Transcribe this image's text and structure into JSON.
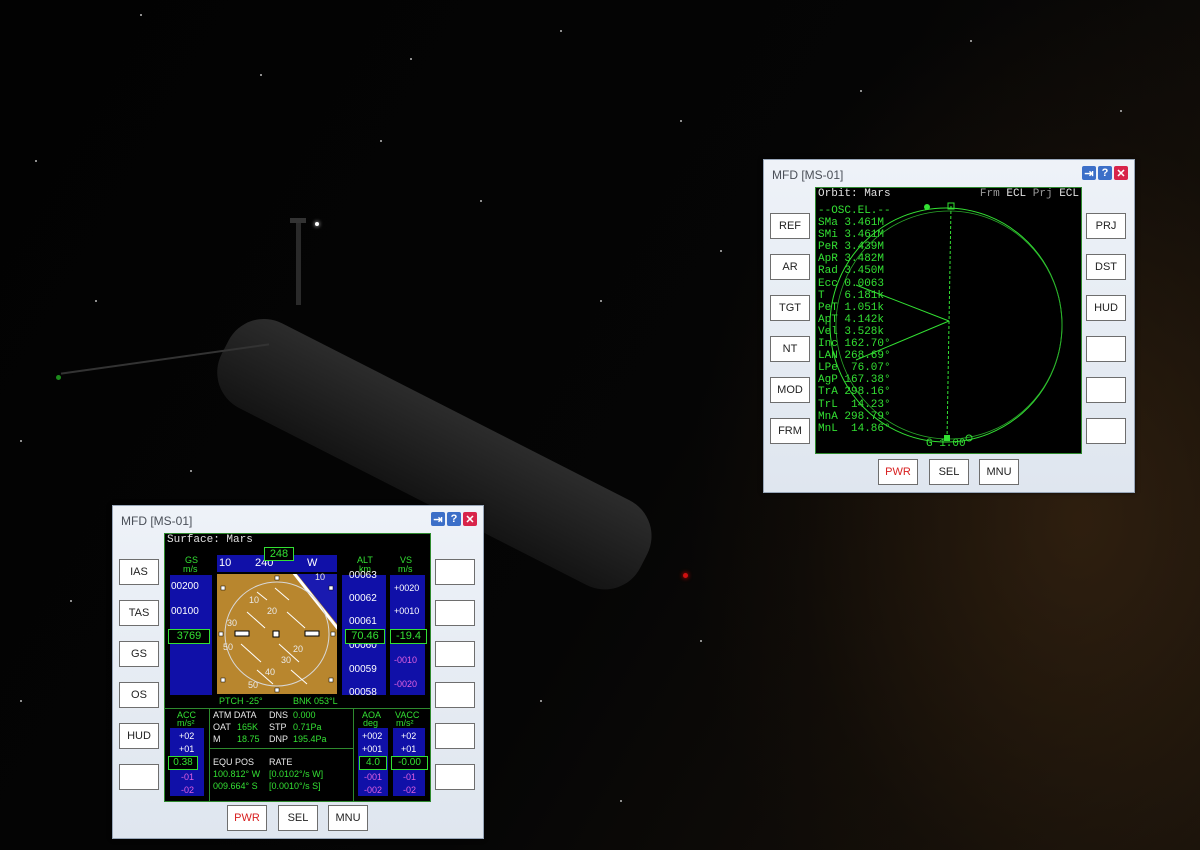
{
  "orbit_mfd": {
    "title": "MFD [MS-01]",
    "header": "Orbit: Mars",
    "frm_label": "Frm",
    "frm_value": "ECL",
    "prj_label": "Prj",
    "prj_value": "ECL",
    "elements_title": "--OSC.EL.--",
    "elements": [
      "SMa 3.461M",
      "SMi 3.461M",
      "PeR 3.439M",
      "ApR 3.482M",
      "Rad 3.450M",
      "Ecc 0.0063",
      "T   6.181k",
      "PeT 1.051k",
      "ApT 4.142k",
      "Vel 3.528k",
      "Inc 162.70°",
      "LAN 268.69°",
      "LPe  76.07°",
      "AgP 167.38°",
      "TrA 298.16°",
      "TrL  14.23°",
      "MnA 298.79°",
      "MnL  14.86°"
    ],
    "g_label": "G 1.00",
    "left_buttons": [
      "REF",
      "AR",
      "TGT",
      "NT",
      "MOD",
      "FRM"
    ],
    "right_buttons": [
      "PRJ",
      "DST",
      "HUD",
      "",
      "",
      ""
    ],
    "bottom_buttons": [
      "PWR",
      "SEL",
      "MNU"
    ]
  },
  "surface_mfd": {
    "title": "MFD [MS-01]",
    "header": "Surface: Mars",
    "left_buttons": [
      "IAS",
      "TAS",
      "GS",
      "OS",
      "HUD",
      ""
    ],
    "right_buttons": [
      "",
      "",
      "",
      "",
      "",
      ""
    ],
    "bottom_buttons": [
      "PWR",
      "SEL",
      "MNU"
    ],
    "gs_label": "GS",
    "gs_unit": "m/s",
    "gs_ticks": [
      "00200",
      "00100"
    ],
    "gs_value": "3769",
    "heading_ticks": [
      "10",
      "240",
      "W"
    ],
    "heading_value": "248",
    "alt_label": "ALT",
    "alt_unit": "km",
    "alt_ticks": [
      "00063",
      "00062",
      "00061",
      "00060",
      "00059",
      "00058"
    ],
    "alt_value": "70.46",
    "vs_label": "VS",
    "vs_unit": "m/s",
    "vs_ticks": [
      "+0020",
      "+0010",
      "-0010",
      "-0020"
    ],
    "vs_value": "-19.4",
    "adi_numbers": [
      "10",
      "20",
      "30",
      "50",
      "30",
      "40",
      "50",
      "20",
      "10"
    ],
    "pitch": "PTCH -25°",
    "bank": "BNK 053°L",
    "acc_label": "ACC",
    "acc_unit": "m/s²",
    "acc_ticks": [
      "+02",
      "+01",
      "-01",
      "-02"
    ],
    "acc_value": "0.38",
    "atm_title": "ATM DATA",
    "oat_label": "OAT",
    "oat_value": "165K",
    "m_label": "M",
    "m_value": "18.75",
    "dns_label": "DNS",
    "dns_value": "0.000",
    "stp_label": "STP",
    "stp_value": "0.71Pa",
    "dnp_label": "DNP",
    "dnp_value": "195.4Pa",
    "equ_title": "EQU POS",
    "equ_lon": "100.812° W",
    "equ_lat": "009.664° S",
    "rate_title": "RATE",
    "rate_lon": "[0.0102°/s W]",
    "rate_lat": "[0.0010°/s S]",
    "aoa_label": "AOA",
    "aoa_unit": "deg",
    "aoa_ticks": [
      "+002",
      "+001",
      "-001",
      "-002"
    ],
    "aoa_value": "4.0",
    "vacc_label": "VACC",
    "vacc_unit": "m/s²",
    "vacc_ticks": [
      "+02",
      "+01",
      "-01",
      "-02"
    ],
    "vacc_value": "-0.00"
  },
  "colors": {
    "mfd_green": "#33e033",
    "tape_blue": "#1010a8",
    "adi_ground": "#b8862e",
    "adi_sky": "#1a1ab0",
    "pwr_red": "#d82020",
    "close_red": "#d8244a"
  }
}
